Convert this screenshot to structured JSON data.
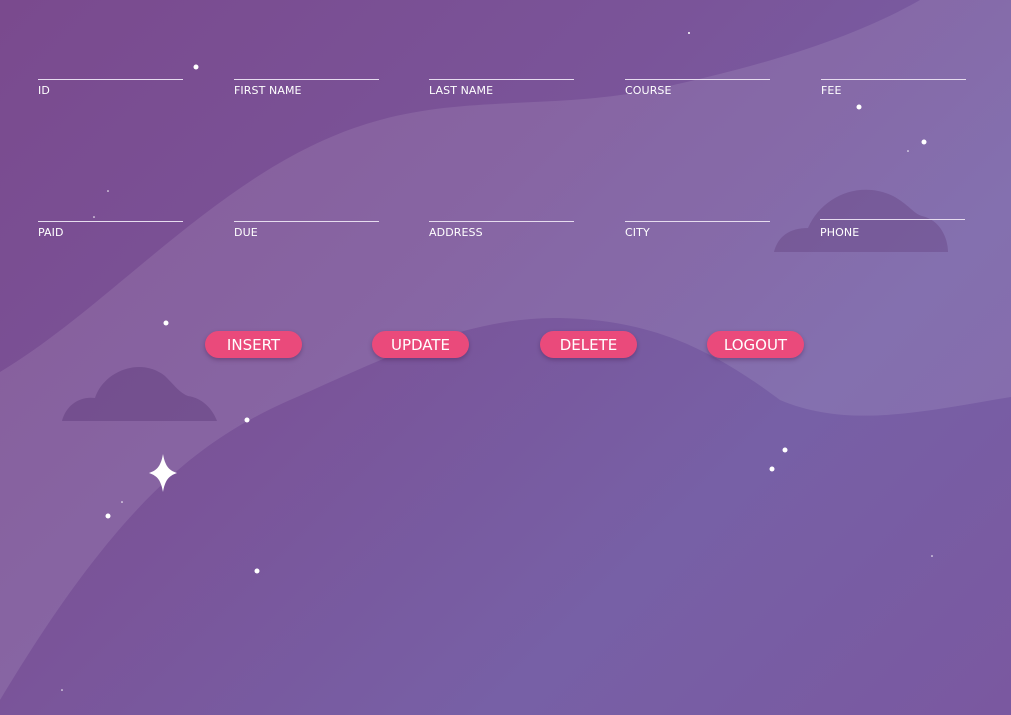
{
  "fields": {
    "id": {
      "label": "ID",
      "value": ""
    },
    "first_name": {
      "label": "FIRST NAME",
      "value": ""
    },
    "last_name": {
      "label": "LAST NAME",
      "value": ""
    },
    "course": {
      "label": "COURSE",
      "value": ""
    },
    "fee": {
      "label": "FEE",
      "value": ""
    },
    "paid": {
      "label": "PAID",
      "value": ""
    },
    "due": {
      "label": "DUE",
      "value": ""
    },
    "address": {
      "label": "ADDRESS",
      "value": ""
    },
    "city": {
      "label": "CITY",
      "value": ""
    },
    "phone": {
      "label": "PHONE",
      "value": ""
    }
  },
  "buttons": {
    "insert": "INSERT",
    "update": "UPDATE",
    "delete": "DELETE",
    "logout": "LOGOUT"
  },
  "colors": {
    "button": "#ea4a7b",
    "text": "#ffffff",
    "underline": "#e6dcef"
  },
  "icons": [
    "sparkle-star-icon",
    "cloud-icon"
  ]
}
